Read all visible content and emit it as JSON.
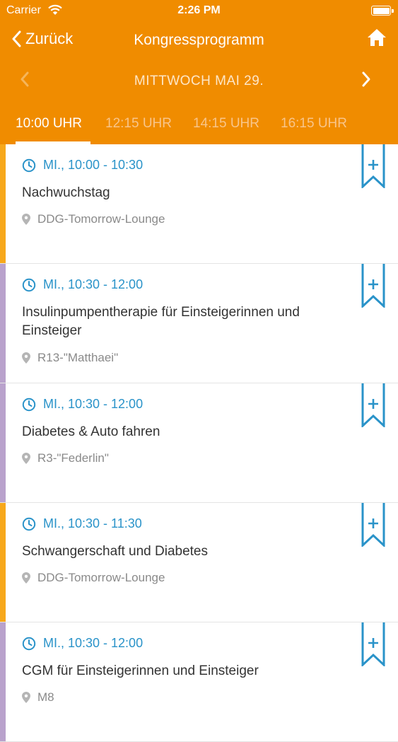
{
  "status_bar": {
    "carrier": "Carrier",
    "time": "2:26 PM"
  },
  "navbar": {
    "back_label": "Zurück",
    "title": "Kongressprogramm"
  },
  "day_selector": {
    "label": "MITTWOCH MAI 29."
  },
  "time_tabs": [
    {
      "label": "10:00 UHR",
      "active": true
    },
    {
      "label": "12:15 UHR",
      "active": false
    },
    {
      "label": "14:15 UHR",
      "active": false
    },
    {
      "label": "16:15 UHR",
      "active": false
    }
  ],
  "colors": {
    "header": "#f08c00",
    "time_text": "#2a93c9",
    "accent_orange": "#f7a81b",
    "accent_purple": "#b9a2cc"
  },
  "sessions": [
    {
      "time": "MI., 10:00 - 10:30",
      "title": "Nachwuchstag",
      "location": "DDG-Tomorrow-Lounge",
      "accent": "#f7a81b"
    },
    {
      "time": "MI., 10:30 - 12:00",
      "title": "Insulinpumpentherapie für Einsteigerinnen und Einsteiger",
      "location": "R13-\"Matthaei\"",
      "accent": "#b9a2cc"
    },
    {
      "time": "MI., 10:30 - 12:00",
      "title": "Diabetes & Auto fahren",
      "location": "R3-\"Federlin\"",
      "accent": "#b9a2cc"
    },
    {
      "time": "MI., 10:30 - 11:30",
      "title": "Schwangerschaft und Diabetes",
      "location": "DDG-Tomorrow-Lounge",
      "accent": "#f7a81b"
    },
    {
      "time": "MI., 10:30 - 12:00",
      "title": "CGM für Einsteigerinnen und Einsteiger",
      "location": "M8",
      "accent": "#b9a2cc"
    }
  ]
}
